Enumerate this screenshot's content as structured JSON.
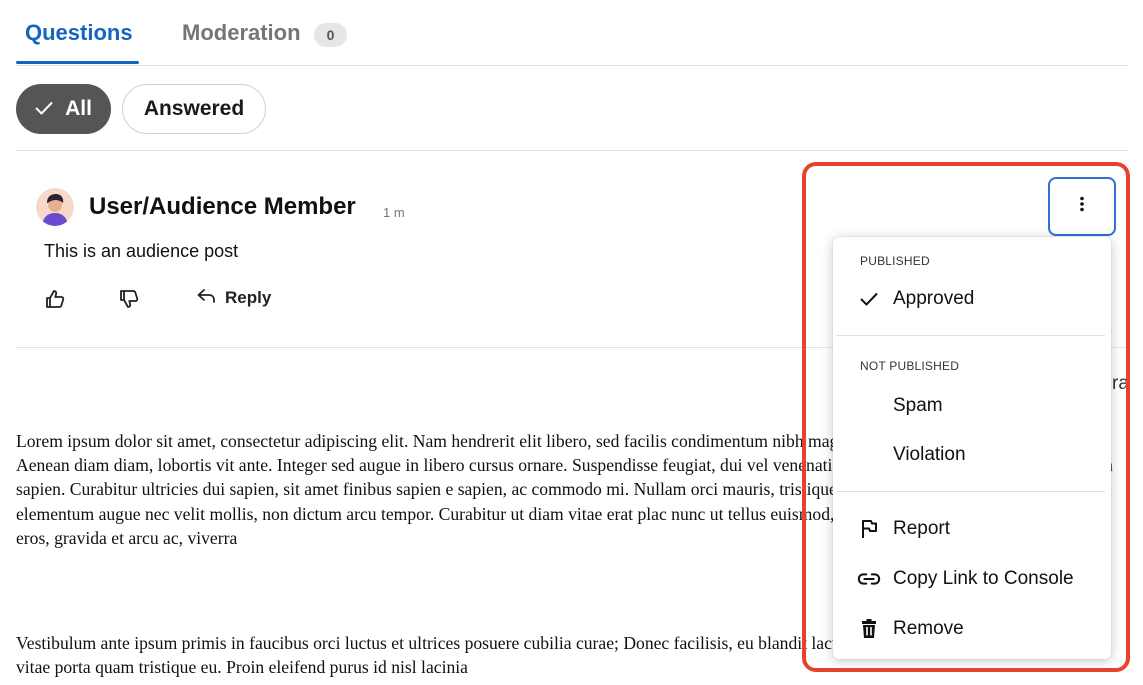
{
  "tabs": [
    {
      "label": "Questions",
      "active": true
    },
    {
      "label": "Moderation",
      "active": false,
      "badge": "0"
    }
  ],
  "filters": [
    {
      "label": "All",
      "selected": true
    },
    {
      "label": "Answered",
      "selected": false
    }
  ],
  "post": {
    "author": "User/Audience Member",
    "time": "1 m",
    "body": "This is an audience post",
    "reply_label": "Reply"
  },
  "menu": {
    "sections": [
      {
        "heading": "PUBLISHED",
        "items": [
          {
            "label": "Approved",
            "icon": "check-icon",
            "checked": true
          }
        ]
      },
      {
        "heading": "NOT PUBLISHED",
        "items": [
          {
            "label": "Spam",
            "checked": false
          },
          {
            "label": "Violation",
            "checked": false
          }
        ]
      },
      {
        "heading": "",
        "items": [
          {
            "label": "Report",
            "icon": "flag-icon"
          },
          {
            "label": "Copy Link to Console",
            "icon": "link-icon"
          },
          {
            "label": "Remove",
            "icon": "trash-icon"
          }
        ]
      }
    ]
  },
  "peek_text": "ra",
  "lorem": {
    "p1": "Lorem ipsum dolor sit amet, consectetur adipiscing elit. Nam hendrerit elit libero, sed facilis condimentum nibh magna, et fringilla elit condimentum vel. Aenean diam diam, lobortis vit ante. Integer sed augue in libero cursus ornare. Suspendisse feugiat, dui vel venenatis males pulvinar tincidunt libero arcu in sapien. Curabitur ultricies dui sapien, sit amet finibus sapien e sapien, ac commodo mi. Nullam orci mauris, tristique eu elementum id, placerat non mi. Pro elementum augue nec velit mollis, non dictum arcu tempor. Curabitur ut diam vitae erat plac nunc ut tellus euismod, quis viverra massa luctus. Nulla erat eros, gravida et arcu ac, viverra",
    "p2": "Vestibulum ante ipsum primis in faucibus orci luctus et ultrices posuere cubilia curae; Donec facilisis, eu blandit lacus aliquet. Fusce tristique orci diam, vitae porta quam tristique eu. Proin eleifend purus id nisl lacinia"
  },
  "colors": {
    "accent": "#1565c0",
    "highlight": "#e8432a",
    "focus": "#2f6fd6",
    "chip_selected": "#555555"
  }
}
